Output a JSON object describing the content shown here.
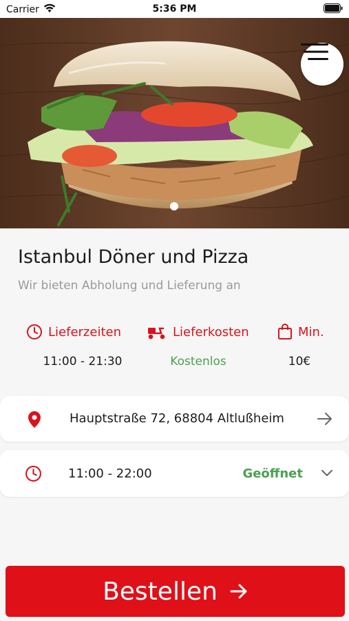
{
  "status_bar": {
    "carrier": "Carrier",
    "time": "5:36 PM"
  },
  "hero": {
    "image_description_icon": "doner-sandwich-image",
    "menu_icon": "hamburger-menu-icon",
    "carousel_total": 1,
    "carousel_active": 1
  },
  "restaurant": {
    "name": "Istanbul Döner und Pizza",
    "subtitle": "Wir bieten Abholung und Lieferung an"
  },
  "stats": {
    "delivery_times_label": "Lieferzeiten",
    "delivery_times_value": "11:00 - 21:30",
    "delivery_cost_label": "Lieferkosten",
    "delivery_cost_value": "Kostenlos",
    "minimum_label": "Min.",
    "minimum_value": "10€"
  },
  "address": {
    "text": "Hauptstraße 72, 68804 Altlußheim"
  },
  "hours": {
    "text": "11:00 - 22:00",
    "status": "Geöffnet"
  },
  "order": {
    "label": "Bestellen"
  },
  "colors": {
    "accent_red": "#e01019",
    "open_green": "#4aa14e",
    "subtitle_gray": "#9a9a9a"
  }
}
